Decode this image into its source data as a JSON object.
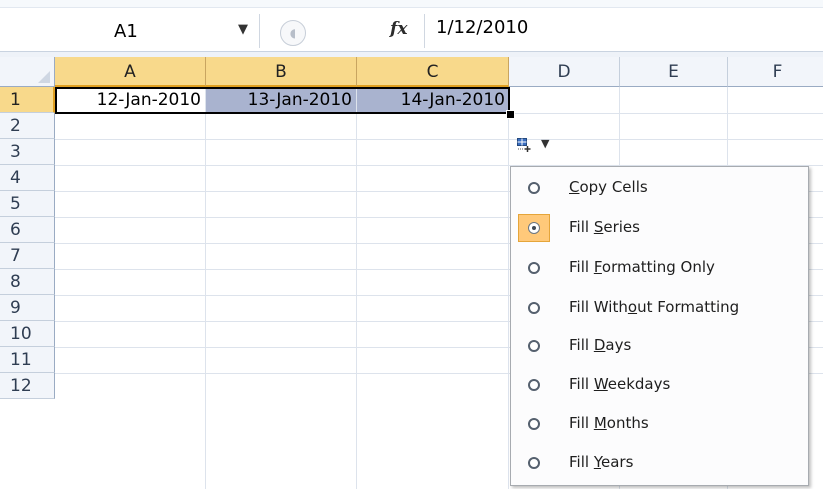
{
  "formula_bar": {
    "name_box": "A1",
    "fx_label": "fx",
    "formula_value": "1/12/2010"
  },
  "columns": [
    "A",
    "B",
    "C",
    "D",
    "E",
    "F"
  ],
  "rows": [
    "1",
    "2",
    "3",
    "4",
    "5",
    "6",
    "7",
    "8",
    "9",
    "10",
    "11",
    "12"
  ],
  "cells": {
    "A1": "12-Jan-2010",
    "B1": "13-Jan-2010",
    "C1": "14-Jan-2010"
  },
  "autofill_menu": {
    "items": [
      {
        "pre": "",
        "key": "C",
        "post": "opy Cells",
        "checked": false
      },
      {
        "pre": "Fill ",
        "key": "S",
        "post": "eries",
        "checked": true
      },
      {
        "pre": "Fill ",
        "key": "F",
        "post": "ormatting Only",
        "checked": false
      },
      {
        "pre": "Fill With",
        "key": "o",
        "post": "ut Formatting",
        "checked": false
      },
      {
        "pre": "Fill ",
        "key": "D",
        "post": "ays",
        "checked": false
      },
      {
        "pre": "Fill ",
        "key": "W",
        "post": "eekdays",
        "checked": false
      },
      {
        "pre": "Fill ",
        "key": "M",
        "post": "onths",
        "checked": false
      },
      {
        "pre": "Fill ",
        "key": "Y",
        "post": "ears",
        "checked": false
      }
    ]
  },
  "colors": {
    "selection_header": "#f8d98b",
    "highlight_cells": "#a9b3cf",
    "menu_checked": "#ffc97a"
  }
}
